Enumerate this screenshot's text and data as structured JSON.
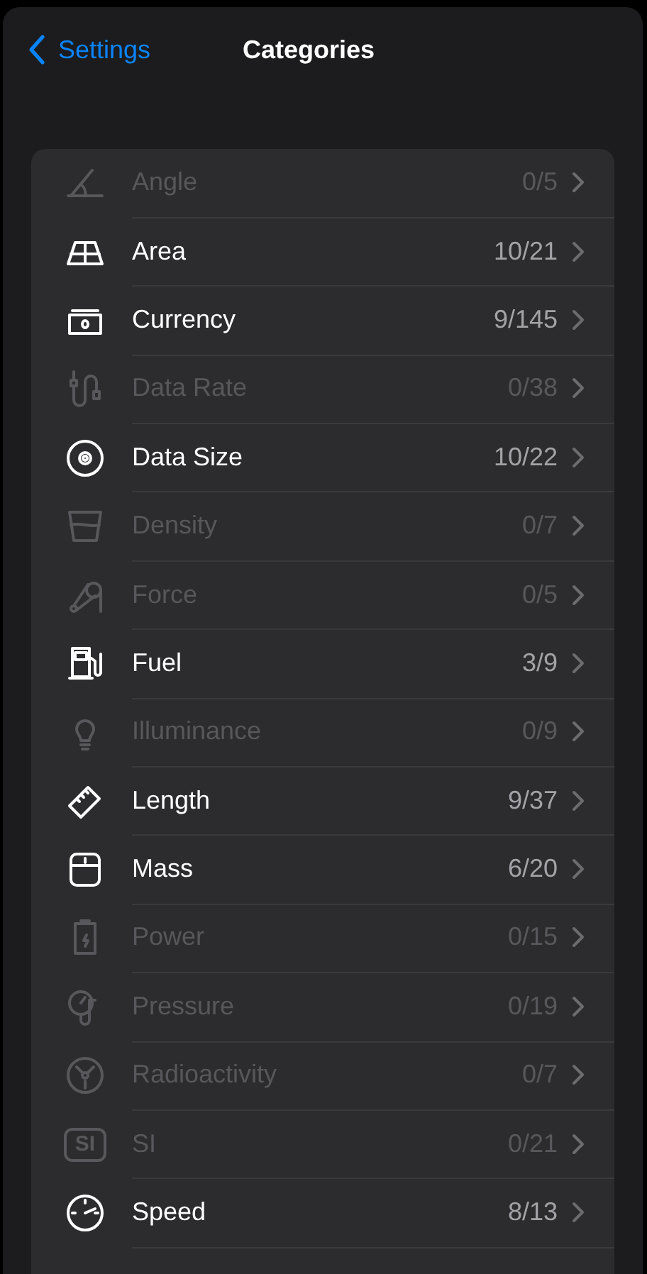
{
  "nav": {
    "back": "Settings",
    "title": "Categories"
  },
  "categories": [
    {
      "name": "Angle",
      "count": "0/5",
      "enabled": false
    },
    {
      "name": "Area",
      "count": "10/21",
      "enabled": true
    },
    {
      "name": "Currency",
      "count": "9/145",
      "enabled": true
    },
    {
      "name": "Data Rate",
      "count": "0/38",
      "enabled": false
    },
    {
      "name": "Data Size",
      "count": "10/22",
      "enabled": true
    },
    {
      "name": "Density",
      "count": "0/7",
      "enabled": false
    },
    {
      "name": "Force",
      "count": "0/5",
      "enabled": false
    },
    {
      "name": "Fuel",
      "count": "3/9",
      "enabled": true
    },
    {
      "name": "Illuminance",
      "count": "0/9",
      "enabled": false
    },
    {
      "name": "Length",
      "count": "9/37",
      "enabled": true
    },
    {
      "name": "Mass",
      "count": "6/20",
      "enabled": true
    },
    {
      "name": "Power",
      "count": "0/15",
      "enabled": false
    },
    {
      "name": "Pressure",
      "count": "0/19",
      "enabled": false
    },
    {
      "name": "Radioactivity",
      "count": "0/7",
      "enabled": false
    },
    {
      "name": "SI",
      "count": "0/21",
      "enabled": false,
      "icon_text": "SI"
    },
    {
      "name": "Speed",
      "count": "8/13",
      "enabled": true
    }
  ]
}
